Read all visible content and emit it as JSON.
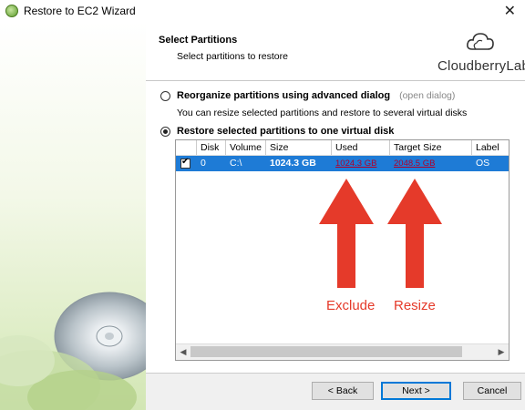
{
  "window": {
    "title": "Restore to EC2 Wizard",
    "icon": "cloudberry-app-icon",
    "close_glyph": "✕"
  },
  "header": {
    "title": "Select Partitions",
    "subtitle": "Select partitions to restore",
    "logo_text": "CloudberryLab",
    "logo_icon": "cloud-icon"
  },
  "options": [
    {
      "label": "Reorganize partitions using advanced dialog",
      "link": "(open dialog)",
      "description": "You can resize selected partitions and restore to several virtual disks",
      "selected": false
    },
    {
      "label": "Restore selected partitions to one virtual disk",
      "selected": true
    }
  ],
  "grid": {
    "columns": [
      "Disk",
      "Volume",
      "Size",
      "Used",
      "Target Size",
      "Label"
    ],
    "rows": [
      {
        "checked": true,
        "disk": "0",
        "volume": "C:\\",
        "size": "1024.3 GB",
        "used": "1024.3 GB",
        "target_size": "2048.5 GB",
        "label": "OS"
      }
    ]
  },
  "annotations": {
    "exclude": "Exclude",
    "resize": "Resize",
    "color": "#e53a2a"
  },
  "scrollbar": {
    "left_arrow": "◀",
    "right_arrow": "▶"
  },
  "buttons": {
    "back": "< Back",
    "next": "Next >",
    "cancel": "Cancel"
  },
  "colors": {
    "selection": "#1e7bd6",
    "accent": "#0078d7"
  }
}
